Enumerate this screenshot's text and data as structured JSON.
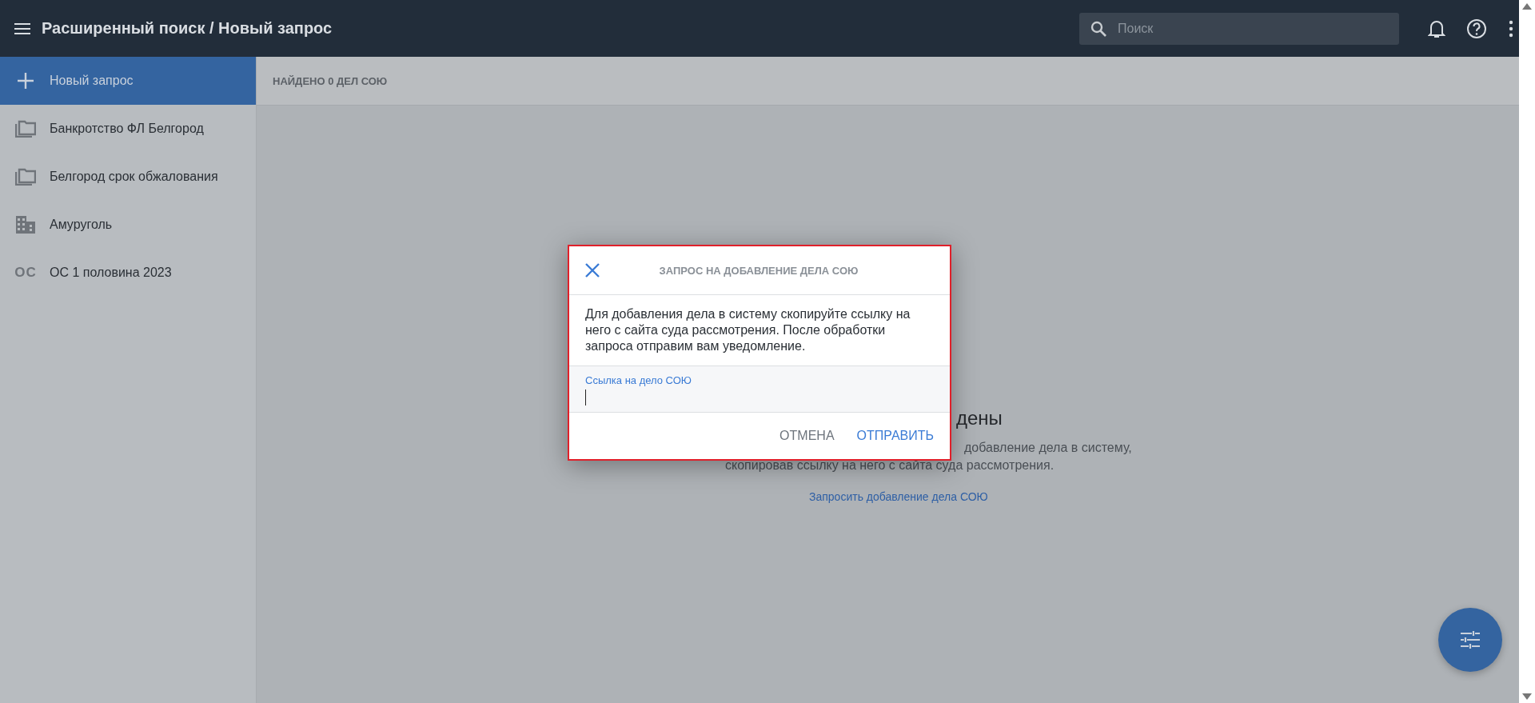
{
  "header": {
    "title": "Расширенный поиск / Новый запрос",
    "search": {
      "placeholder": "Поиск"
    }
  },
  "sidebar": {
    "items": [
      {
        "kind": "add",
        "label": "Новый запрос",
        "selected": true
      },
      {
        "kind": "folder",
        "label": "Банкротство ФЛ Белгород",
        "selected": false
      },
      {
        "kind": "folder",
        "label": "Белгород срок обжалования",
        "selected": false
      },
      {
        "kind": "building",
        "label": "Амуруголь",
        "selected": false
      },
      {
        "kind": "abbrev",
        "abbrev": "ОС",
        "label": "ОС 1 половина 2023",
        "selected": false
      }
    ]
  },
  "results_bar": {
    "text": "НАЙДЕНО 0 ДЕЛ СОЮ"
  },
  "empty_state": {
    "title": "дены",
    "line_1": "добавление дела в систему,",
    "line_2": "скопировав ссылку на него с сайта суда рассмотрения.",
    "link": "Запросить добавление дела СОЮ"
  },
  "dialog": {
    "title": "ЗАПРОС НА ДОБАВЛЕНИЕ ДЕЛА СОЮ",
    "text": "Для добавления дела в систему скопируйте ссылку на него с сайта суда рассмотрения. После обработки запроса отправим вам уведомление.",
    "field": {
      "label": "Ссылка на дело СОЮ"
    },
    "buttons": [
      {
        "kind": "secondary",
        "label": "ОТМЕНА"
      },
      {
        "kind": "primary",
        "label": "ОТПРАВИТЬ"
      }
    ]
  }
}
